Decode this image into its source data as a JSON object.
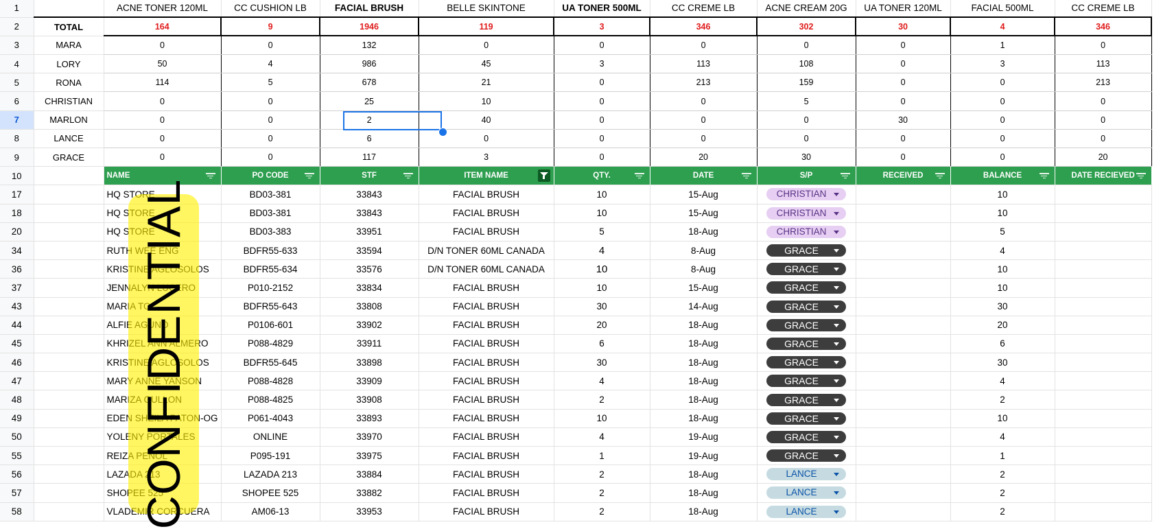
{
  "columns": [
    "ACNE TONER 120ML",
    "CC CUSHION LB",
    "FACIAL BRUSH",
    "BELLE SKINTONE",
    "UA TONER 500ML",
    "CC CREME LB",
    "ACNE CREAM 20G",
    "UA TONER 120ML",
    "FACIAL 500ML",
    "CC CREME LB"
  ],
  "bold_columns": [
    2,
    4
  ],
  "total": {
    "row": "2",
    "label": "TOTAL",
    "values": [
      "164",
      "9",
      "1946",
      "119",
      "3",
      "346",
      "302",
      "30",
      "4",
      "346"
    ]
  },
  "summary": [
    {
      "row": "3",
      "name": "MARA",
      "values": [
        "0",
        "0",
        "132",
        "0",
        "0",
        "0",
        "0",
        "0",
        "1",
        "0"
      ]
    },
    {
      "row": "4",
      "name": "LORY",
      "values": [
        "50",
        "4",
        "986",
        "45",
        "3",
        "113",
        "108",
        "0",
        "3",
        "113"
      ]
    },
    {
      "row": "5",
      "name": "RONA",
      "values": [
        "114",
        "5",
        "678",
        "21",
        "0",
        "213",
        "159",
        "0",
        "0",
        "213"
      ]
    },
    {
      "row": "6",
      "name": "CHRISTIAN",
      "values": [
        "0",
        "0",
        "25",
        "10",
        "0",
        "0",
        "5",
        "0",
        "0",
        "0"
      ]
    },
    {
      "row": "7",
      "name": "MARLON",
      "values": [
        "0",
        "0",
        "2",
        "40",
        "0",
        "0",
        "0",
        "30",
        "0",
        "0"
      ]
    },
    {
      "row": "8",
      "name": "LANCE",
      "values": [
        "0",
        "0",
        "6",
        "0",
        "0",
        "0",
        "0",
        "0",
        "0",
        "0"
      ]
    },
    {
      "row": "9",
      "name": "GRACE",
      "values": [
        "0",
        "0",
        "117",
        "3",
        "0",
        "20",
        "30",
        "0",
        "0",
        "20"
      ]
    }
  ],
  "selected_row": "7",
  "header_row": {
    "row": "10",
    "cols": [
      "NAME",
      "PO CODE",
      "STF",
      "ITEM NAME",
      "QTY.",
      "DATE",
      "S/P",
      "RECEIVED",
      "BALANCE",
      "DATE RECIEVED"
    ],
    "active_filter_col": 3
  },
  "rows": [
    {
      "row": "17",
      "name": "HQ STORE",
      "po": "BD03-381",
      "stf": "33843",
      "item": "FACIAL BRUSH",
      "qty": "10",
      "date": "15-Aug",
      "sp": "CHRISTIAN",
      "received": "",
      "balance": "10",
      "date_received": ""
    },
    {
      "row": "18",
      "name": "HQ STORE",
      "po": "BD03-381",
      "stf": "33843",
      "item": "FACIAL BRUSH",
      "qty": "10",
      "date": "15-Aug",
      "sp": "CHRISTIAN",
      "received": "",
      "balance": "10",
      "date_received": ""
    },
    {
      "row": "20",
      "name": "HQ STORE",
      "po": "BD03-383",
      "stf": "33951",
      "item": "FACIAL BRUSH",
      "qty": "5",
      "date": "18-Aug",
      "sp": "CHRISTIAN",
      "received": "",
      "balance": "5",
      "date_received": ""
    },
    {
      "row": "34",
      "name": "RUTH WEE ENG",
      "po": "BDFR55-633",
      "stf": "33594",
      "item": "D/N TONER 60ML CANADA",
      "qty": "4",
      "date": "8-Aug",
      "sp": "GRACE",
      "received": "",
      "balance": "4",
      "date_received": "",
      "big": true
    },
    {
      "row": "36",
      "name": "KRISTINE AGLOSOLOS",
      "po": "BDFR55-634",
      "stf": "33576",
      "item": "D/N TONER 60ML CANADA",
      "qty": "10",
      "date": "8-Aug",
      "sp": "GRACE",
      "received": "",
      "balance": "10",
      "date_received": "",
      "big": true
    },
    {
      "row": "37",
      "name": "JENNALYN LUCERO",
      "po": "P010-2152",
      "stf": "33834",
      "item": "FACIAL BRUSH",
      "qty": "10",
      "date": "15-Aug",
      "sp": "GRACE",
      "received": "",
      "balance": "10",
      "date_received": ""
    },
    {
      "row": "43",
      "name": "MARIA TO",
      "po": "BDFR55-643",
      "stf": "33808",
      "item": "FACIAL BRUSH",
      "qty": "30",
      "date": "14-Aug",
      "sp": "GRACE",
      "received": "",
      "balance": "30",
      "date_received": ""
    },
    {
      "row": "44",
      "name": "ALFIE AGUNO",
      "po": "P0106-601",
      "stf": "33902",
      "item": "FACIAL BRUSH",
      "qty": "20",
      "date": "18-Aug",
      "sp": "GRACE",
      "received": "",
      "balance": "20",
      "date_received": ""
    },
    {
      "row": "45",
      "name": "KHRIZEL ANN ALMERO",
      "po": "P088-4829",
      "stf": "33911",
      "item": "FACIAL BRUSH",
      "qty": "6",
      "date": "18-Aug",
      "sp": "GRACE",
      "received": "",
      "balance": "6",
      "date_received": ""
    },
    {
      "row": "46",
      "name": "KRISTINE AGLOSOLOS",
      "po": "BDFR55-645",
      "stf": "33898",
      "item": "FACIAL BRUSH",
      "qty": "30",
      "date": "18-Aug",
      "sp": "GRACE",
      "received": "",
      "balance": "30",
      "date_received": ""
    },
    {
      "row": "47",
      "name": "MARY ANNE YANSON",
      "po": "P088-4828",
      "stf": "33909",
      "item": "FACIAL BRUSH",
      "qty": "4",
      "date": "18-Aug",
      "sp": "GRACE",
      "received": "",
      "balance": "4",
      "date_received": ""
    },
    {
      "row": "48",
      "name": "MARIZA GULLON",
      "po": "P088-4825",
      "stf": "33908",
      "item": "FACIAL BRUSH",
      "qty": "2",
      "date": "18-Aug",
      "sp": "GRACE",
      "received": "",
      "balance": "2",
      "date_received": ""
    },
    {
      "row": "49",
      "name": "EDEN SHEILA PATON-OG",
      "po": "P061-4043",
      "stf": "33893",
      "item": "FACIAL BRUSH",
      "qty": "10",
      "date": "18-Aug",
      "sp": "GRACE",
      "received": "",
      "balance": "10",
      "date_received": ""
    },
    {
      "row": "50",
      "name": "YOLENY PORTALES",
      "po": "ONLINE",
      "stf": "33970",
      "item": "FACIAL BRUSH",
      "qty": "4",
      "date": "19-Aug",
      "sp": "GRACE",
      "received": "",
      "balance": "4",
      "date_received": ""
    },
    {
      "row": "55",
      "name": "REIZA PENOL",
      "po": "P095-191",
      "stf": "33975",
      "item": "FACIAL BRUSH",
      "qty": "1",
      "date": "19-Aug",
      "sp": "GRACE",
      "received": "",
      "balance": "1",
      "date_received": ""
    },
    {
      "row": "56",
      "name": "LAZADA 213",
      "po": "LAZADA 213",
      "stf": "33884",
      "item": "FACIAL BRUSH",
      "qty": "2",
      "date": "18-Aug",
      "sp": "LANCE",
      "received": "",
      "balance": "2",
      "date_received": ""
    },
    {
      "row": "57",
      "name": "SHOPEE 525",
      "po": "SHOPEE 525",
      "stf": "33882",
      "item": "FACIAL BRUSH",
      "qty": "2",
      "date": "18-Aug",
      "sp": "LANCE",
      "received": "",
      "balance": "2",
      "date_received": ""
    },
    {
      "row": "58",
      "name": "VLADEMIR CORCUERA",
      "po": "AM06-13",
      "stf": "33953",
      "item": "FACIAL BRUSH",
      "qty": "2",
      "date": "18-Aug",
      "sp": "LANCE",
      "received": "",
      "balance": "2",
      "date_received": ""
    }
  ],
  "watermark": "CONFIDENTIAL",
  "colors": {
    "header_green": "#2e9e4f",
    "total_red": "#e01b1b",
    "selection_blue": "#1a73e8",
    "watermark_yellow": "#fff000"
  }
}
